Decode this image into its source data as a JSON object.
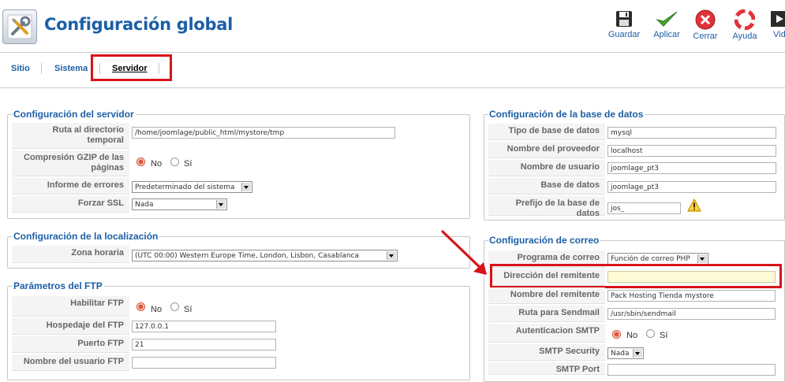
{
  "header": {
    "title": "Configuración global",
    "toolbar": [
      {
        "label": "Guardar",
        "icon": "save-icon"
      },
      {
        "label": "Aplicar",
        "icon": "check-icon"
      },
      {
        "label": "Cerrar",
        "icon": "close-icon"
      },
      {
        "label": "Ayuda",
        "icon": "help-icon"
      },
      {
        "label": "Vid",
        "icon": "video-icon"
      }
    ]
  },
  "tabs": [
    {
      "label": "Sitio",
      "active": false
    },
    {
      "label": "Sistema",
      "active": false
    },
    {
      "label": "Servidor",
      "active": true
    }
  ],
  "server": {
    "legend": "Configuración del servidor",
    "tmp_label": "Ruta al directorio temporal",
    "tmp_value": "/home/joomlage/public_html/mystore/tmp",
    "gzip_label": "Compresión GZIP de las páginas",
    "gzip_no": "No",
    "gzip_si": "Sí",
    "errors_label": "Informe de errores",
    "errors_value": "Predeterminado del sistema",
    "ssl_label": "Forzar SSL",
    "ssl_value": "Nada"
  },
  "locale": {
    "legend": "Configuración de la localización",
    "tz_label": "Zona horaria",
    "tz_value": "(UTC 00:00) Western Europe Time, London, Lisbon, Casablanca"
  },
  "ftp": {
    "legend": "Parámetros del FTP",
    "enable_label": "Habilitar FTP",
    "no": "No",
    "si": "Sí",
    "host_label": "Hospedaje del FTP",
    "host_value": "127.0.0.1",
    "port_label": "Puerto FTP",
    "port_value": "21",
    "user_label": "Nombre del usuario FTP",
    "user_value": ""
  },
  "database": {
    "legend": "Configuración de la base de datos",
    "type_label": "Tipo de base de datos",
    "type_value": "mysql",
    "host_label": "Nombre del proveedor",
    "host_value": "localhost",
    "user_label": "Nombre de usuario",
    "user_value": "joomlage_pt3",
    "db_label": "Base de datos",
    "db_value": "joomlage_pt3",
    "prefix_label": "Prefijo de la base de datos",
    "prefix_value": "jos_"
  },
  "mail": {
    "legend": "Configuración de correo",
    "program_label": "Programa de correo",
    "program_value": "Función de correo PHP",
    "from_label": "Dirección del remitente",
    "from_value": "",
    "name_label": "Nombre del remitente",
    "name_value": "Pack Hosting Tienda mystore",
    "sendmail_label": "Ruta para Sendmail",
    "sendmail_value": "/usr/sbin/sendmail",
    "smtpauth_label": "Autenticacion SMTP",
    "no": "No",
    "si": "Sí",
    "security_label": "SMTP Security",
    "security_value": "Nada",
    "port_label": "SMTP Port",
    "port_value": ""
  },
  "colors": {
    "accent": "#1c5fa6",
    "highlight": "#d8121a",
    "field_highlight": "#fffbd6"
  }
}
